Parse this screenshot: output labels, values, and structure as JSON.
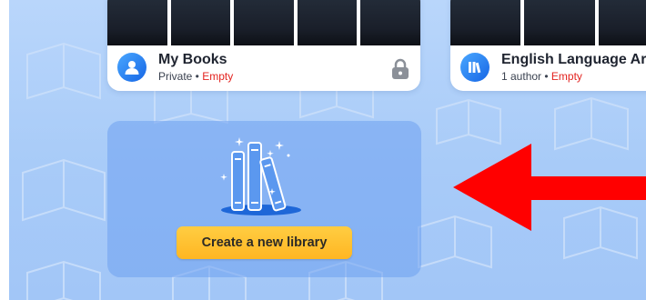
{
  "libraries": [
    {
      "title": "My Books",
      "meta_prefix": "Private • ",
      "status": "Empty",
      "icon": "user-icon",
      "trailing_icon": "lock-icon"
    },
    {
      "title": "English Language Ar",
      "meta_prefix": "1 author • ",
      "status": "Empty",
      "icon": "library-books-icon"
    }
  ],
  "new_library": {
    "button_label": "Create a new library",
    "illustration": "books-illustration"
  },
  "annotation": {
    "icon": "red-arrow-left",
    "color": "#ff0000"
  },
  "colors": {
    "accent_button": "#ffc02e",
    "status_empty": "#e3231f",
    "avatar_blue": "#1e7bf0"
  }
}
